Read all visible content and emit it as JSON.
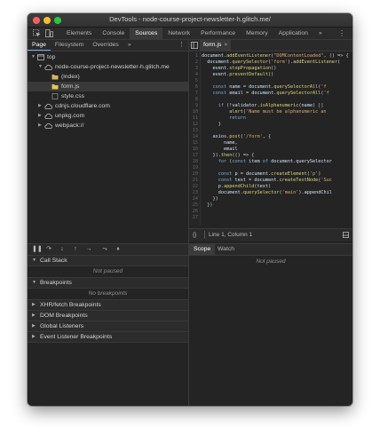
{
  "window": {
    "title": "DevTools - node-course-project-newsletter-h.glitch.me/"
  },
  "main_tabs": [
    "Elements",
    "Console",
    "Sources",
    "Network",
    "Performance",
    "Memory",
    "Application"
  ],
  "main_more": "»",
  "sources_subtabs": [
    "Page",
    "Filesystem",
    "Overrides"
  ],
  "subtab_more": "»",
  "kebab": "⋮",
  "tree": {
    "top": "top",
    "origin": "node-course-project-newsletter-h.glitch.me",
    "index": "(index)",
    "formjs": "form.js",
    "stylecss": "style.css",
    "cdn1": "cdnjs.cloudflare.com",
    "cdn2": "unpkg.com",
    "webpack": "webpack://"
  },
  "editor": {
    "tab_label": "form.js",
    "tab_close": "×",
    "status": "Line 1, Column 1",
    "status_brace": "{}",
    "lines": [
      "document.addEventListener(\"DOMContentLoaded\", () => {",
      "  document.querySelector('form').addEventListener(",
      "    event.stopPropagation()",
      "    event.preventDefault()",
      "",
      "    const name = document.querySelectorAll('f",
      "    const email = document.querySelectorAll('f",
      "",
      "      if (!validator.isAlphanumeric(name) || ",
      "          alert('Name must be alphanumeric an",
      "          return",
      "      }",
      "",
      "    axios.post('/form', {",
      "        name,",
      "        email",
      "    }).then(() => {",
      "      for (const item of document.querySelector",
      "",
      "      const p = document.createElement('p')",
      "      const text = document.createTextNode('Suc",
      "      p.appendChild(text)",
      "      document.querySelector('main').appendChil",
      "    })",
      "  })",
      "",
      ""
    ]
  },
  "debugger": {
    "sections": {
      "callstack": "Call Stack",
      "breakpoints": "Breakpoints",
      "xhr": "XHR/fetch Breakpoints",
      "dom": "DOM Breakpoints",
      "global": "Global Listeners",
      "event": "Event Listener Breakpoints"
    },
    "not_paused": "Not paused",
    "no_breakpoints": "No breakpoints"
  },
  "scope": {
    "tabs": [
      "Scope",
      "Watch"
    ],
    "not_paused": "Not paused"
  },
  "colors": {
    "close": "#fc5f57",
    "minimize": "#fdbc2e",
    "maximize": "#28c840",
    "folder": "#d9b25b",
    "file_js": "#e6c84e",
    "selection": "#7cacf8"
  }
}
